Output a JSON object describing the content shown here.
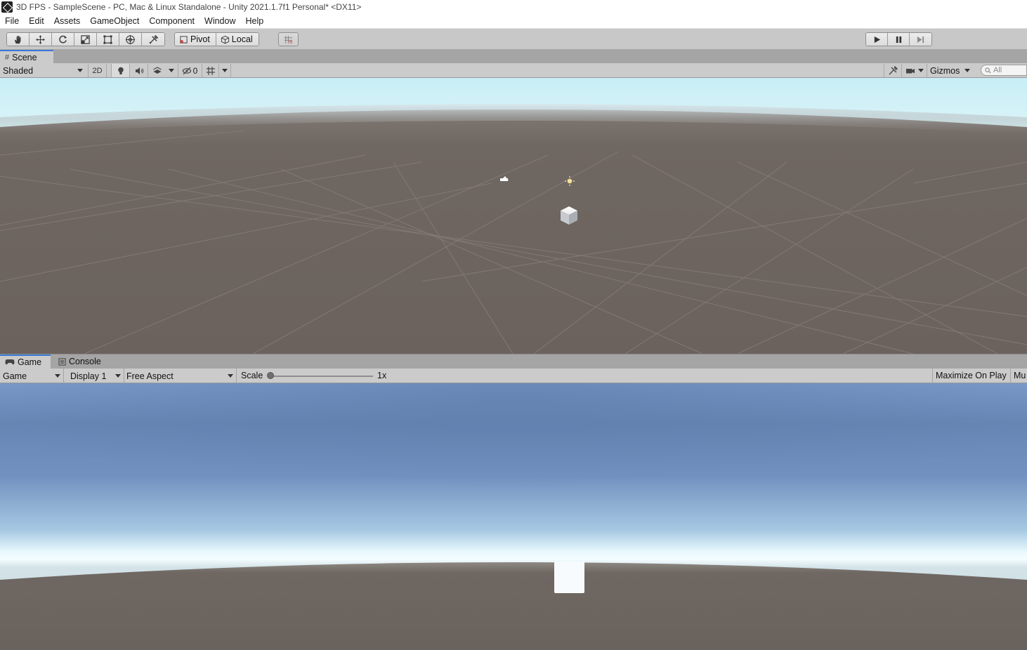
{
  "window": {
    "title": "3D FPS - SampleScene - PC, Mac & Linux Standalone - Unity 2021.1.7f1 Personal* <DX11>"
  },
  "menu": [
    "File",
    "Edit",
    "Assets",
    "GameObject",
    "Component",
    "Window",
    "Help"
  ],
  "toolbar": {
    "tools": [
      "hand-tool",
      "move-tool",
      "rotate-tool",
      "scale-tool",
      "rect-tool",
      "transform-tool",
      "custom-tool"
    ],
    "pivot_label": "Pivot",
    "local_label": "Local",
    "play_controls": [
      "play",
      "pause",
      "step"
    ]
  },
  "scene_panel": {
    "tab_label": "Scene",
    "shading_mode": "Shaded",
    "toggle_2d": "2D",
    "hidden_count": "0",
    "gizmos_label": "Gizmos",
    "search_placeholder": "All"
  },
  "game_panel": {
    "tabs": [
      "Game",
      "Console"
    ],
    "view_mode": "Game",
    "display": "Display 1",
    "aspect": "Free Aspect",
    "scale_label": "Scale",
    "scale_value": "1x",
    "scale_fraction": 0.0,
    "maximize_label": "Maximize On Play",
    "mute_label": "Mu"
  },
  "colors": {
    "accent": "#3a79d7",
    "panel_bg": "#cbcbcb",
    "ground": "#6b625d",
    "sky_game": "#6d8fbe",
    "horizon": "#f0fbff"
  }
}
